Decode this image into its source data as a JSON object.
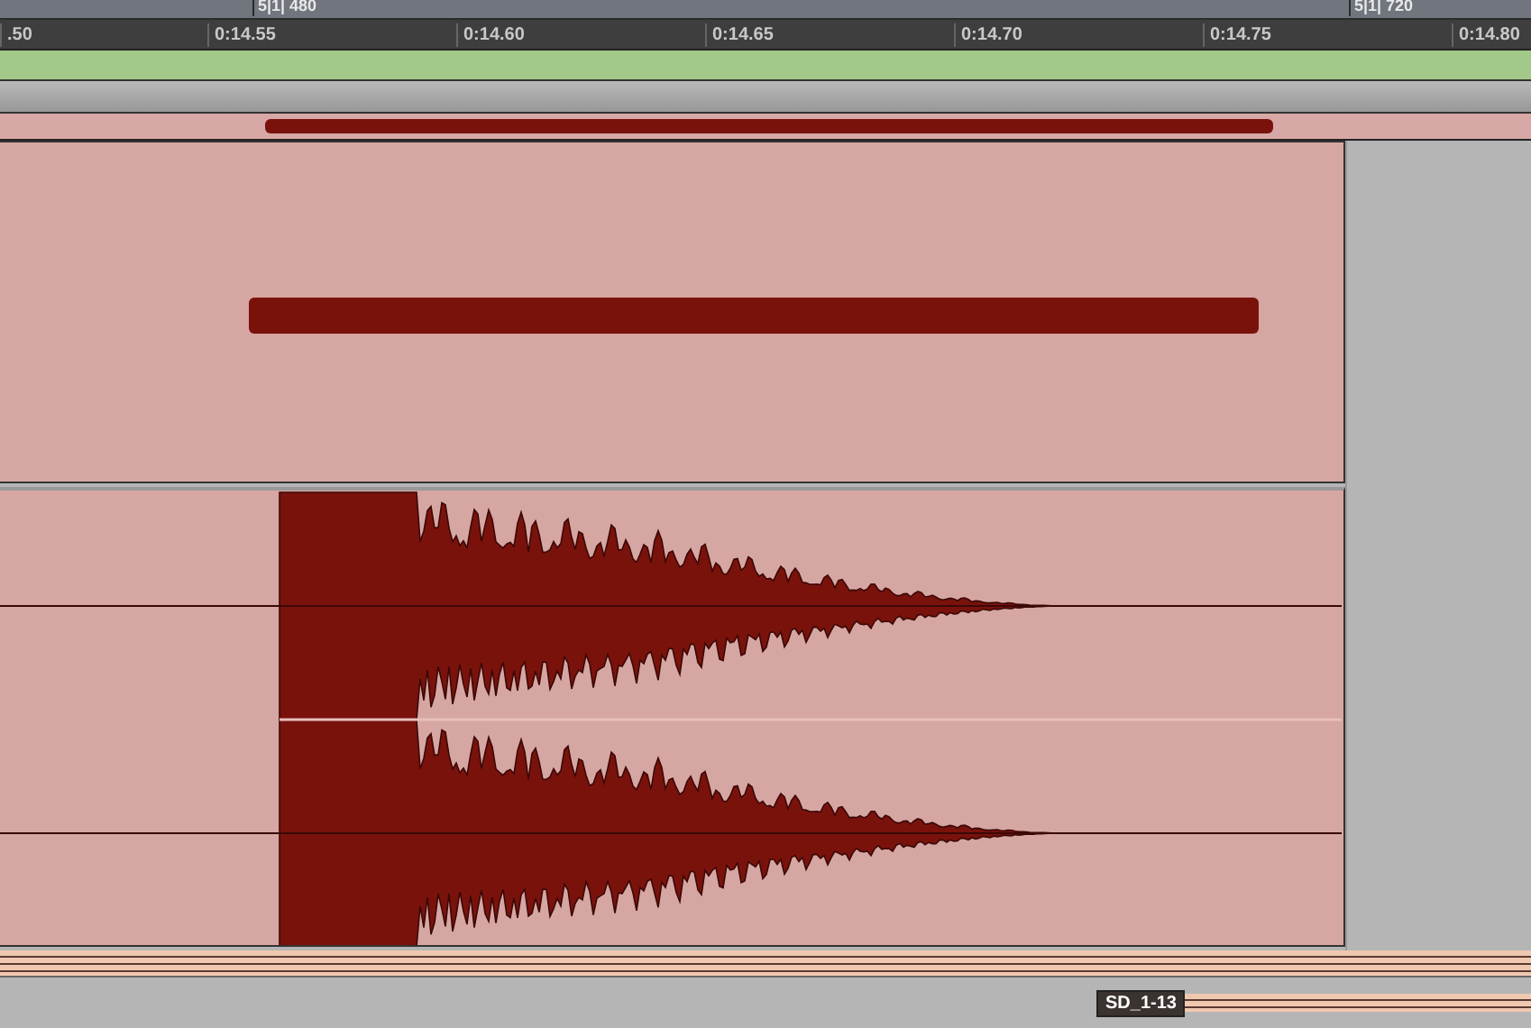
{
  "bar_ruler": {
    "markers": [
      "5|1| 480",
      "5|1| 720"
    ]
  },
  "timecode_ruler": {
    "ticks": [
      ".50",
      "0:14.55",
      "0:14.60",
      "0:14.65",
      "0:14.70",
      "0:14.75",
      "0:14.80"
    ]
  },
  "clip_label": "SD_1-13"
}
